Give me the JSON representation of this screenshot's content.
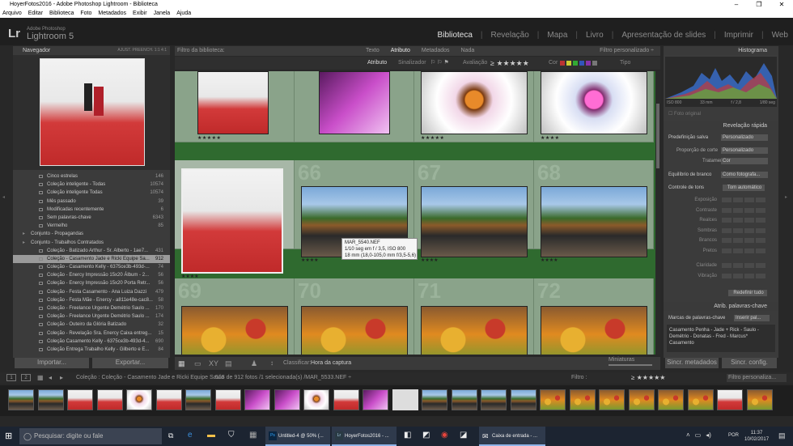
{
  "window": {
    "title": "HoyerFotos2016 - Adobe Photoshop Lightroom - Biblioteca"
  },
  "menu": [
    "Arquivo",
    "Editar",
    "Biblioteca",
    "Foto",
    "Metadados",
    "Exibir",
    "Janela",
    "Ajuda"
  ],
  "brand": {
    "small": "Adobe Photoshop",
    "name": "Lightroom 5",
    "logo": "Lr"
  },
  "modules": [
    "Biblioteca",
    "Revelação",
    "Mapa",
    "Livro",
    "Apresentação de slides",
    "Imprimir",
    "Web"
  ],
  "navigator": {
    "title": "Navegador",
    "opts": "AJUST.   PREENCH.   1:1   4:1"
  },
  "collections": [
    {
      "label": "Cinco estrelas",
      "count": "146"
    },
    {
      "label": "Coleção inteligente - Todas",
      "count": "10574"
    },
    {
      "label": "Coleção inteligente Todas",
      "count": "10574"
    },
    {
      "label": "Mês passado",
      "count": "39"
    },
    {
      "label": "Modificadas recentemente",
      "count": "6"
    },
    {
      "label": "Sem palavras-chave",
      "count": "6343"
    },
    {
      "label": "Vermelho",
      "count": "85"
    },
    {
      "label": "Conjunto - Propagandas",
      "count": "",
      "set": true
    },
    {
      "label": "Conjunto - Trabalhos Contratados",
      "count": "",
      "set": true
    },
    {
      "label": "Coleção - Batizado Arthur - Sr. Alberto - 1ae7...",
      "count": "431"
    },
    {
      "label": "Coleção - Casamento Jade e Ricki Equipe Sa...",
      "count": "912",
      "sel": true
    },
    {
      "label": "Coleção - Casamento Kelly - 6375ce3b-493d-...",
      "count": "74"
    },
    {
      "label": "Coleção - Enercy Impressão 15x20 Álbum - 2...",
      "count": "56"
    },
    {
      "label": "Coleção - Enercy Impressão 15x20 Porta Retr...",
      "count": "56"
    },
    {
      "label": "Coleção - Festa Casamento - Ana  Luiza Dazzi",
      "count": "479"
    },
    {
      "label": "Coleção - Festa Mãe - Enercy - a811e48e-cac8...",
      "count": "58"
    },
    {
      "label": "Coleção - Freelance Urgente Demétrio Saulo ...",
      "count": "170"
    },
    {
      "label": "Coleção - Freelance Urgente Demétrio Saulo ...",
      "count": "174"
    },
    {
      "label": "Coleção - Outeiro da Glória Batizado",
      "count": "32"
    },
    {
      "label": "Coleção - Revelação Sra. Enercy Caixa entreg...",
      "count": "15"
    },
    {
      "label": "Coleção Casamento Kelly - 6375ce3b-493d-4...",
      "count": "690"
    },
    {
      "label": "Coleção Entrega Trabalho Kelly - Gilberto e E...",
      "count": "84"
    }
  ],
  "left_buttons": {
    "import": "Importar...",
    "export": "Exportar..."
  },
  "filter": {
    "title": "Filtro da biblioteca:",
    "tabs": [
      "Texto",
      "Atributo",
      "Metadados",
      "Nada"
    ],
    "active": "Atributo",
    "custom": "Filtro personalizado ÷",
    "attr_label": "Atributo",
    "flag_label": "Sinalizador",
    "rating_label": "Avaliação",
    "color_label": "Cor",
    "type_label": "Tipo"
  },
  "grid": {
    "row_numbers": [
      "66",
      "67",
      "68",
      "69",
      "70",
      "71",
      "72"
    ],
    "stars": "★★★★★",
    "stars3": "★★★★"
  },
  "tooltip": {
    "line1": "MAR_5540.NEF",
    "line2": "1/10 seg em f / 3,5, ISO 800",
    "line3": "18 mm (18,0-105,0 mm f/3,5-5,6)"
  },
  "toolbar": {
    "sort_label": "Classificar:",
    "sort_value": "Hora da captura",
    "thumbs_label": "Miniaturas"
  },
  "histogram": {
    "title": "Histograma",
    "iso": "ISO 800",
    "focal": "33 mm",
    "aperture": "f / 2,8",
    "shutter": "1/80 seg",
    "orig": "Foto original"
  },
  "quick_develop": {
    "title": "Revelação rápida",
    "preset_label": "Predefinição salva",
    "preset_value": "Personalizado",
    "crop_label": "Proporção de corte",
    "crop_value": "Personalizado",
    "treat_label": "Tratamento",
    "treat_value": "Cor",
    "wb_label": "Equilíbrio de branco",
    "wb_value": "Como fotografa...",
    "tone_label": "Controle de tons",
    "tone_value": "Tom automático",
    "sliders": [
      "Exposição",
      "Contraste",
      "Realces",
      "Sombras",
      "Brancos",
      "Pretos",
      "Claridade",
      "Vibração"
    ],
    "reset": "Redefinir tudo"
  },
  "keywords": {
    "title": "Atrib. palavras-chave",
    "label": "Marcas de palavras-chave",
    "select": "Inserir pal...",
    "text": "Casamento Penha - Jade + Rick - Saulo - Demétrio - Donatas - Fred - Marcus* Casamento"
  },
  "right_buttons": {
    "sync_meta": "Sincr. metadados",
    "sync_cfg": "Sincr. config."
  },
  "filmstrip": {
    "path": "Coleção : Coleção - Casamento Jade e Ricki Equipe Saulo",
    "count": "518 de 912 fotos /1 selecionada(s) /MAR_5533.NEF ÷",
    "filter": "Filtro :",
    "filter_value": "Filtro personaliza..."
  },
  "taskbar": {
    "search": "Pesquisar: digite ou fale",
    "apps": [
      "Untitled-4 @ 50% (...",
      "HoyerFotos2016 - ...",
      "Caixa de entrada - ..."
    ],
    "lang": "POR",
    "time": "11:37",
    "date": "10/02/2017"
  }
}
